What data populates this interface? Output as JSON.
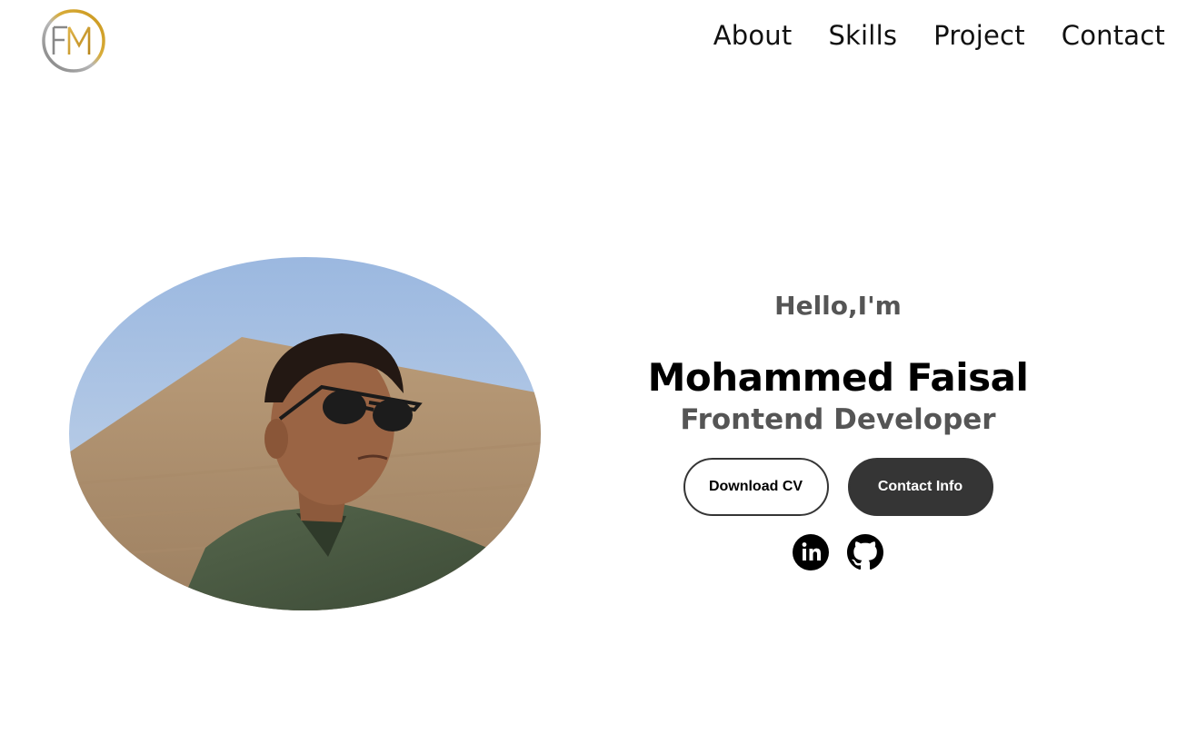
{
  "header": {
    "logo_text": "FM",
    "nav": [
      {
        "label": "About"
      },
      {
        "label": "Skills"
      },
      {
        "label": "Project"
      },
      {
        "label": "Contact"
      }
    ]
  },
  "hero": {
    "greeting": "Hello,I'm",
    "name": "Mohammed Faisal",
    "role": "Frontend Developer",
    "buttons": {
      "download_cv": "Download CV",
      "contact_info": "Contact Info"
    },
    "socials": [
      {
        "icon": "linkedin-icon"
      },
      {
        "icon": "github-icon"
      }
    ]
  },
  "colors": {
    "background": "#ffffff",
    "text": "#000000",
    "muted_text": "#555555",
    "button_dark": "#353535",
    "logo_gold": "#d4a62a",
    "logo_gray": "#8a8a8a"
  }
}
